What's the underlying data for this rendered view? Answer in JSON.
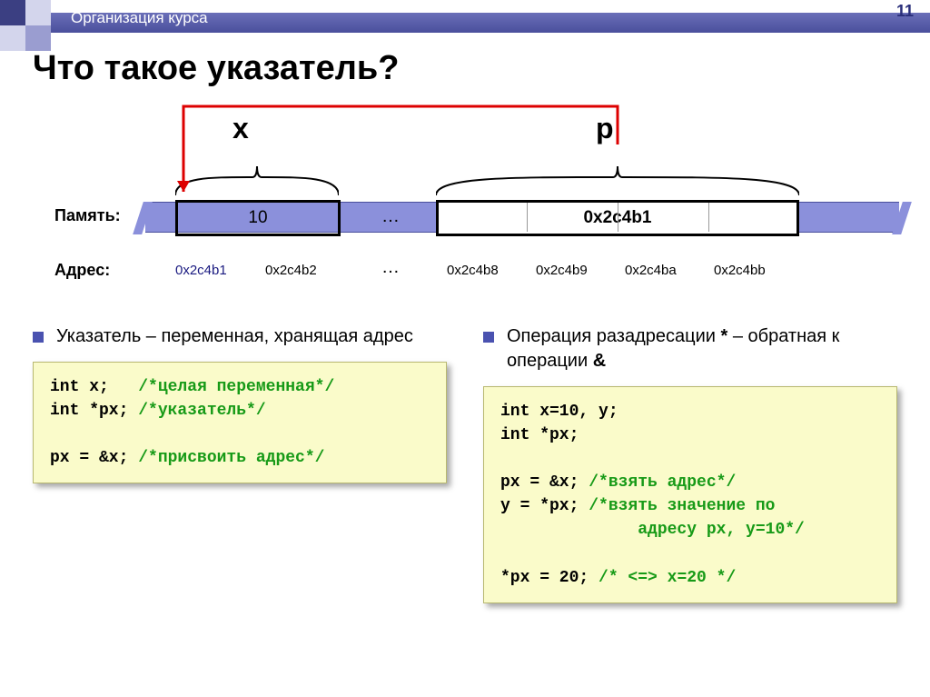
{
  "header": {
    "breadcrumb": "Организация курса",
    "page": "11"
  },
  "title": "Что такое указатель?",
  "diagram": {
    "var_x": "x",
    "var_p": "p",
    "mem_label": "Память:",
    "addr_label": "Адрес:",
    "x_value": "10",
    "ellipsis": "…",
    "p_value": "0x2c4b1",
    "addrs": {
      "a1": "0x2c4b1",
      "a2": "0x2c4b2",
      "ae": "…",
      "b1": "0x2c4b8",
      "b2": "0x2c4b9",
      "b3": "0x2c4ba",
      "b4": "0x2c4bb"
    }
  },
  "left": {
    "bullet": "Указатель – переменная, хранящая адрес",
    "code": {
      "l1a": "int x;   ",
      "l1b": "/*целая переменная*/",
      "l2a": "int *px; ",
      "l2b": "/*указатель*/",
      "l3": "",
      "l4a": "px = &x; ",
      "l4b": "/*присвоить адрес*/"
    }
  },
  "right": {
    "bullet_pre": "Операция разадресации ",
    "bullet_star": "*",
    "bullet_mid": " – обратная к операции ",
    "bullet_amp": "&",
    "code": {
      "l1": "int x=10, y;",
      "l2": "int *px;",
      "l3": "",
      "l4a": "px = &x; ",
      "l4b": "/*взять адрес*/",
      "l5a": "y = *px; ",
      "l5b": "/*взять значение по",
      "l5c": "              адресу px, y=10*/",
      "l6": "",
      "l7a": "*px = 20; ",
      "l7b": "/* <=> x=20 */"
    }
  }
}
